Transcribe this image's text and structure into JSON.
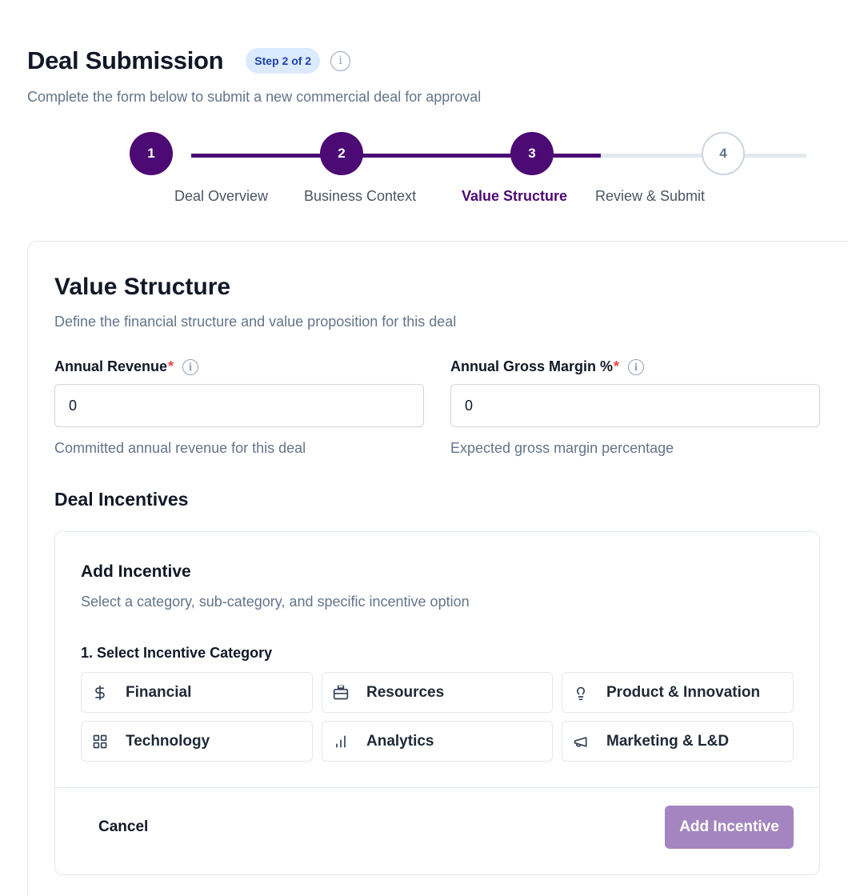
{
  "page": {
    "title": "Deal Submission",
    "step_badge": "Step 2 of 2",
    "subtitle": "Complete the form below to submit a new commercial deal for approval",
    "info_icon": "info-icon"
  },
  "stepper": {
    "steps": [
      {
        "number": "1",
        "label": "Deal Overview",
        "state": "complete"
      },
      {
        "number": "2",
        "label": "Business Context",
        "state": "complete"
      },
      {
        "number": "3",
        "label": "Value Structure",
        "state": "current"
      },
      {
        "number": "4",
        "label": "Review & Submit",
        "state": "pending"
      }
    ],
    "colors": {
      "active": "#4c0a74",
      "inactive": "#e2e8f0"
    }
  },
  "section": {
    "title": "Value Structure",
    "description": "Define the financial structure and value proposition for this deal"
  },
  "fields": {
    "annual_revenue": {
      "label": "Annual Revenue",
      "required_mark": "*",
      "value": "0",
      "help": "Committed annual revenue for this deal"
    },
    "gross_margin": {
      "label": "Annual Gross Margin %",
      "required_mark": "*",
      "value": "0",
      "help": "Expected gross margin percentage"
    }
  },
  "incentives": {
    "section_title": "Deal Incentives",
    "panel_title": "Add Incentive",
    "panel_description": "Select a category, sub-category, and specific incentive option",
    "category_label": "1. Select Incentive Category",
    "categories": [
      {
        "label": "Financial",
        "icon": "dollar-icon"
      },
      {
        "label": "Resources",
        "icon": "briefcase-icon"
      },
      {
        "label": "Product & Innovation",
        "icon": "lightbulb-icon"
      },
      {
        "label": "Technology",
        "icon": "grid-icon"
      },
      {
        "label": "Analytics",
        "icon": "bar-chart-icon"
      },
      {
        "label": "Marketing & L&D",
        "icon": "megaphone-icon"
      }
    ],
    "cancel_label": "Cancel",
    "add_label": "Add Incentive",
    "add_color": "#a485c0"
  }
}
